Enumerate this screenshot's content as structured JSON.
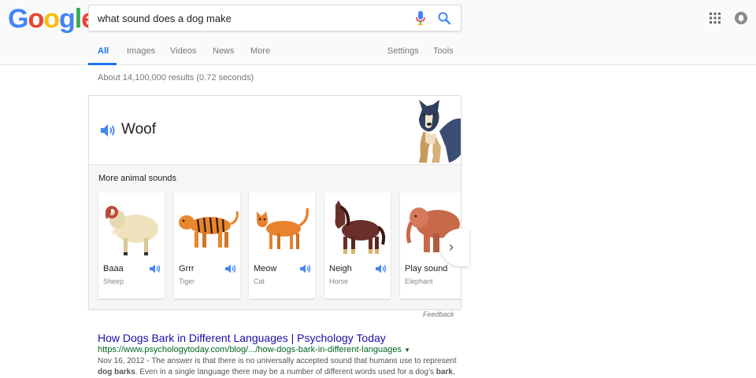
{
  "header": {
    "logo": [
      "G",
      "o",
      "o",
      "g",
      "l",
      "e"
    ],
    "logo_colors": [
      "#4285F4",
      "#EA4335",
      "#FBBC05",
      "#4285F4",
      "#34A853",
      "#EA4335"
    ],
    "query": "what sound does a dog make"
  },
  "tabs": [
    {
      "label": "All",
      "active": true
    },
    {
      "label": "Images"
    },
    {
      "label": "Videos"
    },
    {
      "label": "News"
    },
    {
      "label": "More"
    }
  ],
  "tools": {
    "settings": "Settings",
    "tools": "Tools"
  },
  "stats": "About 14,100,000 results (0.72 seconds)",
  "card": {
    "main_sound": "Woof",
    "more_title": "More animal sounds",
    "animals": [
      {
        "sound": "Baaa",
        "name": "Sheep"
      },
      {
        "sound": "Grrr",
        "name": "Tiger"
      },
      {
        "sound": "Meow",
        "name": "Cat"
      },
      {
        "sound": "Neigh",
        "name": "Horse"
      },
      {
        "sound": "Play sound",
        "name": "Elephant"
      }
    ],
    "feedback": "Feedback"
  },
  "result": {
    "title": "How Dogs Bark in Different Languages | Psychology Today",
    "url": "https://www.psychologytoday.com/blog/.../how-dogs-bark-in-different-languages",
    "date": "Nov 16, 2012",
    "snippet_1": " - The answer is that there is no universally accepted sound that humans use to represent ",
    "snippet_b1": "dog barks",
    "snippet_2": ". Even in a single language there may be a number of different words used for a dog's ",
    "snippet_b2": "bark",
    "snippet_3": ","
  },
  "colors": {
    "accent": "#1a73e8",
    "link": "#1a0dab",
    "url": "#006621"
  }
}
